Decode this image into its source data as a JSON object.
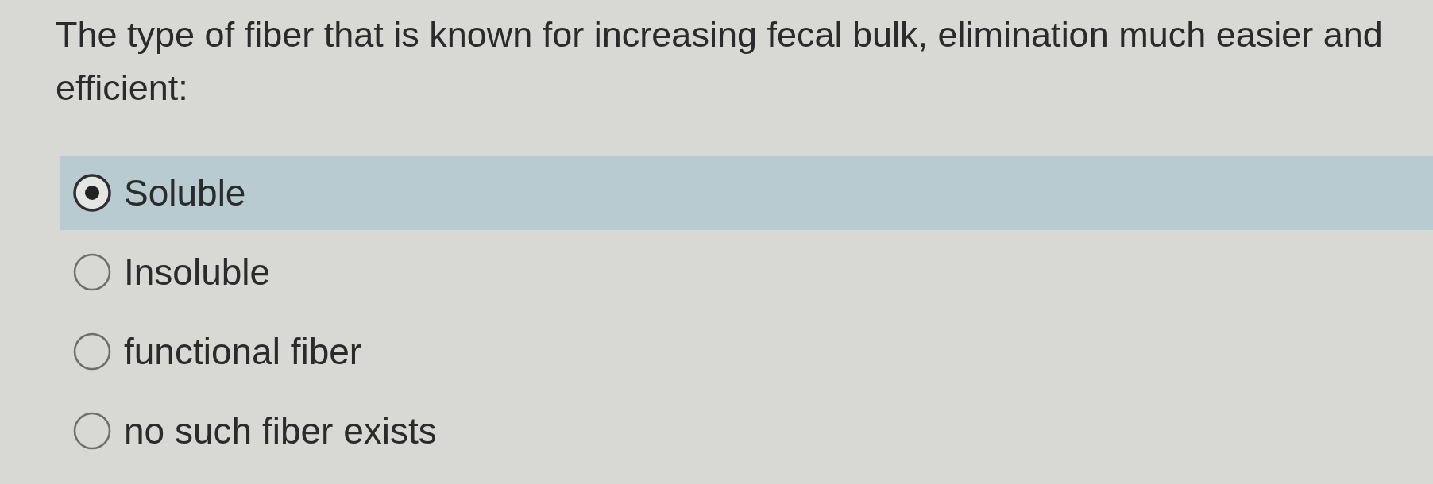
{
  "question": {
    "text": "The type of fiber that is known for increasing fecal bulk, elimination much easier and efficient:"
  },
  "options": [
    {
      "label": "Soluble",
      "selected": true
    },
    {
      "label": "Insoluble",
      "selected": false
    },
    {
      "label": "functional fiber",
      "selected": false
    },
    {
      "label": "no such fiber exists",
      "selected": false
    }
  ]
}
